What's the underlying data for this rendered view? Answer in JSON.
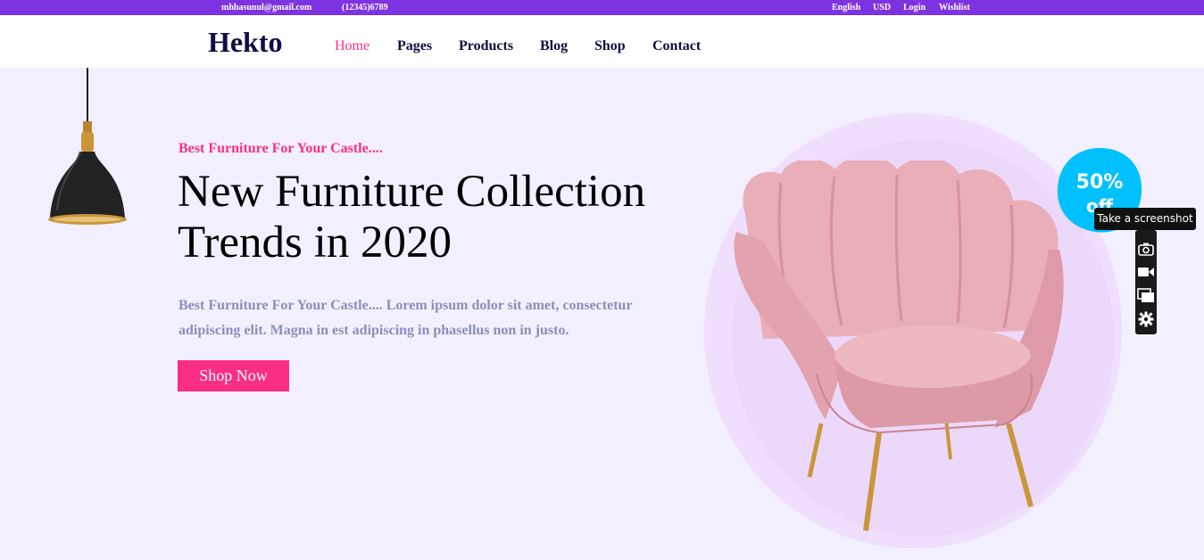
{
  "topbar": {
    "email": "mhhasunul@gmail.com",
    "phone": "(12345)6789",
    "language": "English",
    "currency": "USD",
    "login": "Login",
    "wishlist": "Wishlist"
  },
  "header": {
    "logo": "Hekto",
    "nav": [
      "Home",
      "Pages",
      "Products",
      "Blog",
      "Shop",
      "Contact"
    ]
  },
  "hero": {
    "tagline": "Best Furniture For Your Castle....",
    "headline_line1": "New Furniture Collection",
    "headline_line2": "Trends in 2020",
    "description": "Best Furniture For Your Castle.... Lorem ipsum dolor sit amet, consectetur adipiscing elit. Magna in est adipiscing in phasellus non in justo.",
    "button": "Shop Now",
    "badge_percent": "50%",
    "badge_off": "off"
  },
  "extension": {
    "tooltip": "Take a screenshot",
    "tools": [
      "camera-icon",
      "video-icon",
      "windows-icon",
      "gear-icon"
    ]
  },
  "colors": {
    "topbar": "#7E33E0",
    "accent": "#FB2E86",
    "navy": "#0D0E43",
    "hero_bg": "#F2F0FF",
    "badge": "#00C1FE"
  }
}
